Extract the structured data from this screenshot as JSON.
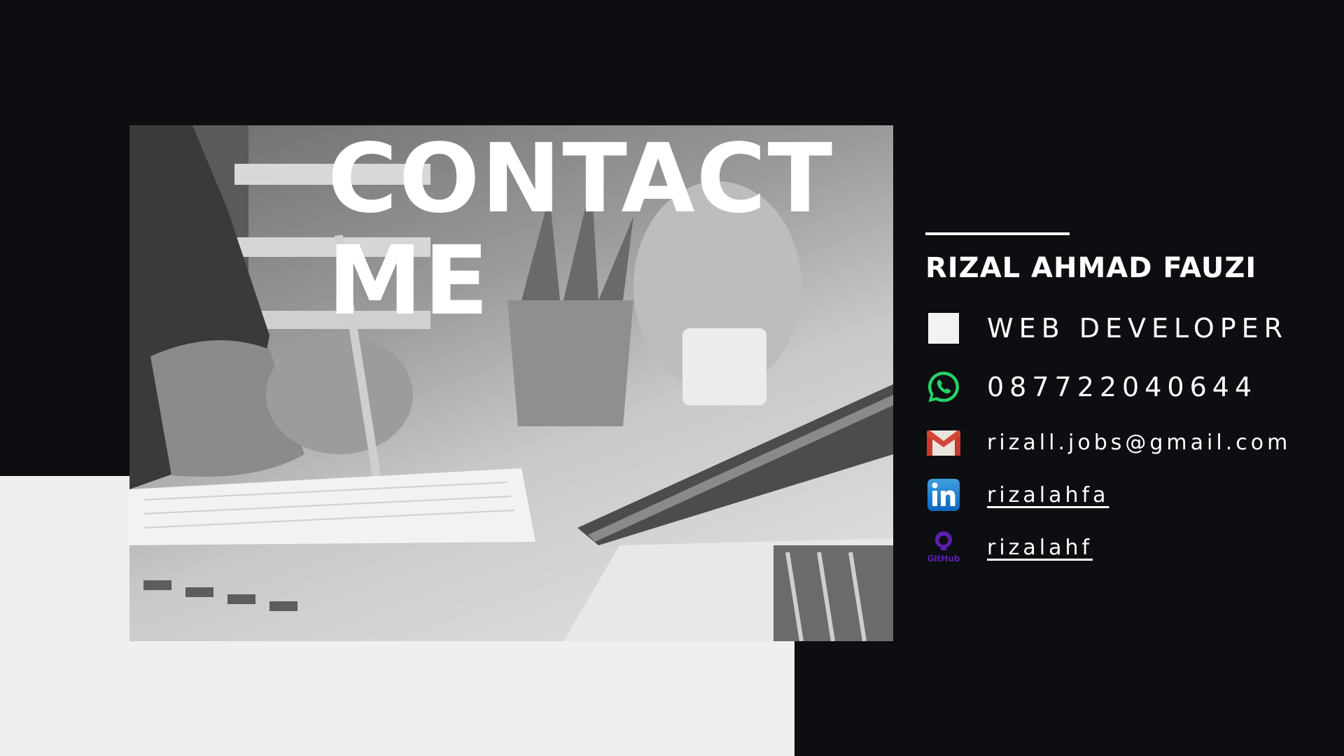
{
  "headline": {
    "line1": "CONTACT",
    "line2": "ME"
  },
  "profile": {
    "name": "RIZAL AHMAD FAUZI",
    "role": "WEB DEVELOPER"
  },
  "contacts": {
    "phone": "087722040644",
    "email": "rizall.jobs@gmail.com",
    "linkedin": "rizalahfa",
    "github": "rizalahf"
  },
  "icons": {
    "role": "square-icon",
    "phone": "whatsapp-icon",
    "email": "gmail-icon",
    "linkedin": "linkedin-icon",
    "github": "github-icon"
  },
  "github_icon_label": "GitHub",
  "colors": {
    "background": "#0d0e11",
    "light_block": "#efefef",
    "text": "#ffffff",
    "whatsapp": "#25d366",
    "gmail_red": "#d44638",
    "linkedin_blue": "#0a66c2",
    "github_purple": "#5b1fb0"
  }
}
